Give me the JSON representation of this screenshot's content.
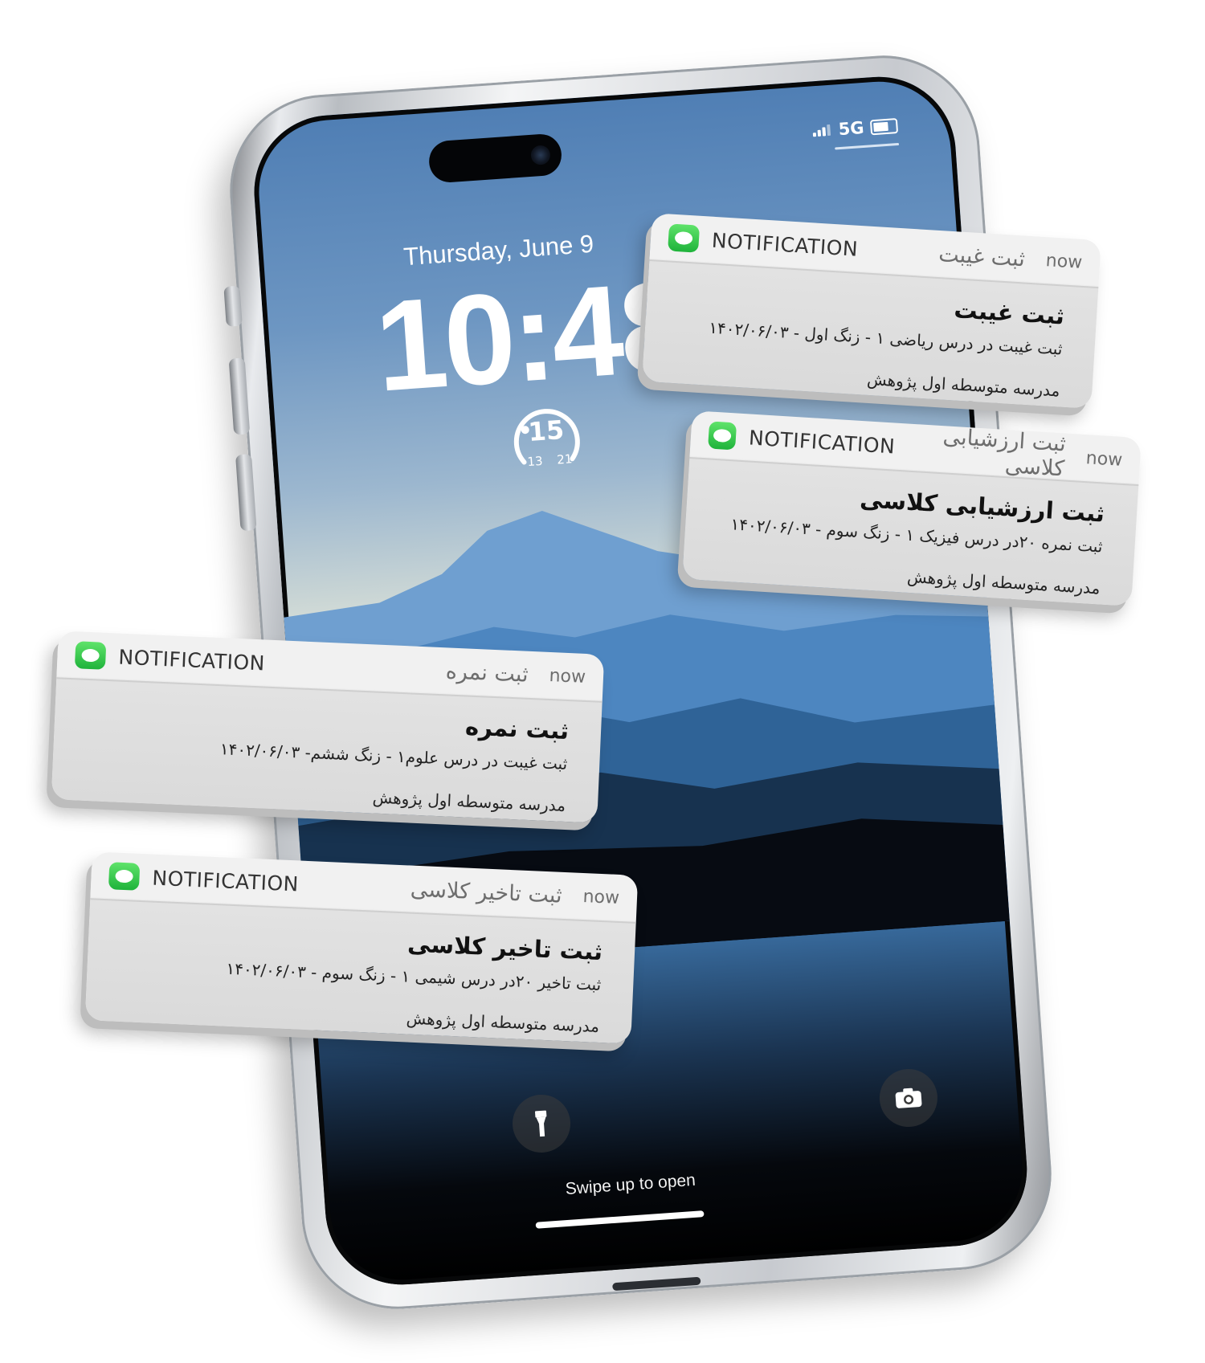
{
  "lock_screen": {
    "status": {
      "network": "5G"
    },
    "date": "Thursday, June 9",
    "time": "10:48",
    "weather_widget": {
      "current": "15",
      "low": "13",
      "high": "21"
    },
    "swipe_hint": "Swipe up to open"
  },
  "notifications": [
    {
      "app": "NOTIFICATION",
      "header_title": "ثبت غیبت",
      "time": "now",
      "title": "ثبت غیبت",
      "message": "ثبت غیبت در درس ریاضی ۱ - زنگ اول - ۱۴۰۲/۰۶/۰۳",
      "school": "مدرسه متوسطه اول پژوهش"
    },
    {
      "app": "NOTIFICATION",
      "header_title": "ثبت ارزشیابی کلاسی",
      "time": "now",
      "title": "ثبت ارزشیابی کلاسی",
      "message": "ثبت نمره ۲۰در درس فیزیک ۱ - زنگ سوم - ۱۴۰۲/۰۶/۰۳",
      "school": "مدرسه متوسطه اول پژوهش"
    },
    {
      "app": "NOTIFICATION",
      "header_title": "ثبت نمره",
      "time": "now",
      "title": "ثبت نمره",
      "message": "ثبت غیبت در درس علوم۱ - زنگ ششم- ۱۴۰۲/۰۶/۰۳",
      "school": "مدرسه متوسطه اول پژوهش"
    },
    {
      "app": "NOTIFICATION",
      "header_title": "ثبت تاخیر کلاسی",
      "time": "now",
      "title": "ثبت تاخیر کلاسی",
      "message": "ثبت تاخیر ۲۰در درس شیمی ۱ - زنگ سوم - ۱۴۰۲/۰۶/۰۳",
      "school": "مدرسه متوسطه اول پژوهش"
    }
  ],
  "colors": {
    "app_icon": "#2fc24a",
    "card_header": "#f1f1f1",
    "card_body": "#dedede"
  }
}
